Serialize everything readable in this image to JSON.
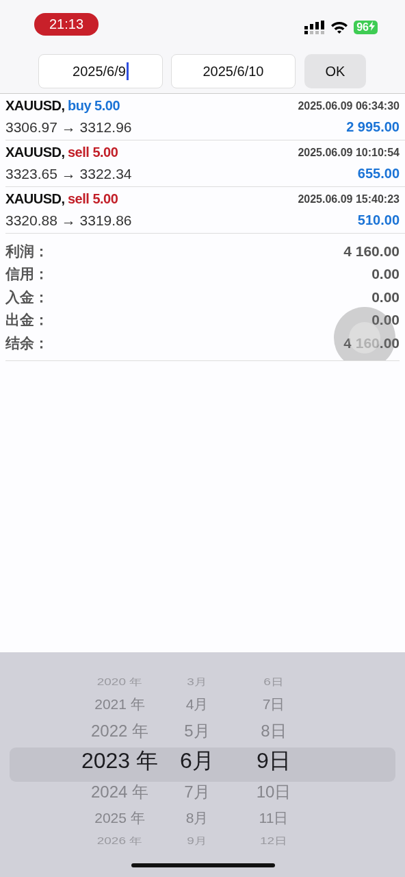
{
  "status_bar": {
    "time": "21:13",
    "battery": "96"
  },
  "date_range": {
    "fields": [
      {
        "value": "2025/6/9",
        "focused": true
      },
      {
        "value": "2025/6/10",
        "focused": false
      }
    ],
    "ok_button": "OK"
  },
  "trades": [
    {
      "symbol": "XAUUSD,",
      "side": "buy",
      "volume": "5.00",
      "time": "2025.06.09 06:34:30",
      "prices": "3306.97 → 3312.96",
      "profit": "2 995.00"
    },
    {
      "symbol": "XAUUSD,",
      "side": "sell",
      "volume": "5.00",
      "time": "2025.06.09 10:10:54",
      "prices": "3323.65 → 3322.34",
      "profit": "655.00"
    },
    {
      "symbol": "XAUUSD,",
      "side": "sell",
      "volume": "5.00",
      "time": "2025.06.09 15:40:23",
      "prices": "3320.88 → 3319.86",
      "profit": "510.00"
    }
  ],
  "summary": [
    {
      "label": "利润：",
      "value": "4 160.00"
    },
    {
      "label": "信用：",
      "value": "0.00"
    },
    {
      "label": "入金：",
      "value": "0.00"
    },
    {
      "label": "出金：",
      "value": "0.00"
    },
    {
      "label": "结余：",
      "value": "4 160.00"
    }
  ],
  "date_picker": {
    "columns": [
      {
        "items": [
          {
            "label": "2020 年",
            "selected": false
          },
          {
            "label": "2021 年",
            "selected": false
          },
          {
            "label": "2022 年",
            "selected": false
          },
          {
            "label": "2023 年",
            "selected": true
          },
          {
            "label": "2024 年",
            "selected": false
          },
          {
            "label": "2025 年",
            "selected": false
          },
          {
            "label": "2026 年",
            "selected": false
          }
        ]
      },
      {
        "items": [
          {
            "label": "3月",
            "selected": false
          },
          {
            "label": "4月",
            "selected": false
          },
          {
            "label": "5月",
            "selected": false
          },
          {
            "label": "6月",
            "selected": true
          },
          {
            "label": "7月",
            "selected": false
          },
          {
            "label": "8月",
            "selected": false
          },
          {
            "label": "9月",
            "selected": false
          }
        ]
      },
      {
        "items": [
          {
            "label": "6日",
            "selected": false
          },
          {
            "label": "7日",
            "selected": false
          },
          {
            "label": "8日",
            "selected": false
          },
          {
            "label": "9日",
            "selected": true
          },
          {
            "label": "10日",
            "selected": false
          },
          {
            "label": "11日",
            "selected": false
          },
          {
            "label": "12日",
            "selected": false
          }
        ]
      }
    ]
  }
}
